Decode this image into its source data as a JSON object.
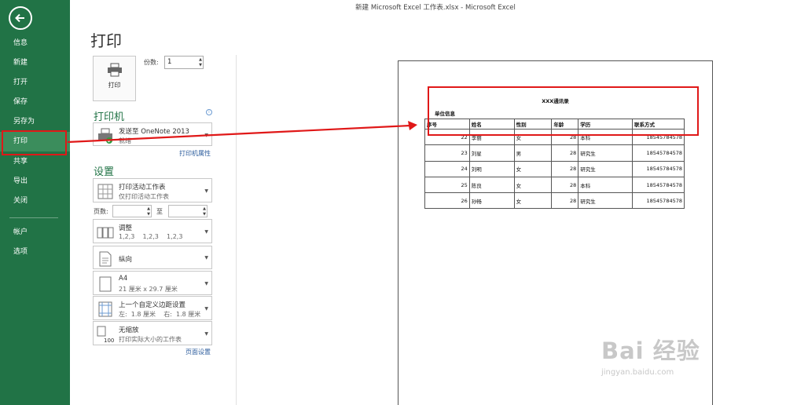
{
  "window": {
    "title": "新建 Microsoft Excel 工作表.xlsx - Microsoft Excel"
  },
  "nav": {
    "back_icon": "back-arrow-icon",
    "items": [
      {
        "label": "信息"
      },
      {
        "label": "新建"
      },
      {
        "label": "打开"
      },
      {
        "label": "保存"
      },
      {
        "label": "另存为"
      },
      {
        "label": "打印",
        "active": true
      },
      {
        "label": "共享"
      },
      {
        "label": "导出"
      },
      {
        "label": "关闭"
      },
      {
        "label": "帐户"
      },
      {
        "label": "选项"
      }
    ]
  },
  "print": {
    "heading": "打印",
    "button_label": "打印",
    "copies_label": "份数:",
    "copies_value": "1"
  },
  "printer": {
    "heading": "打印机",
    "name": "发送至 OneNote 2013",
    "status": "就绪",
    "properties_link": "打印机属性"
  },
  "settings": {
    "heading": "设置",
    "print_what": {
      "title": "打印活动工作表",
      "subtitle": "仅打印活动工作表"
    },
    "pages_label": "页数:",
    "pages_to_label": "至",
    "collate": {
      "title": "调整",
      "subtitle": "1,2,3    1,2,3    1,2,3"
    },
    "orientation": {
      "title": "纵向"
    },
    "paper": {
      "title": "A4",
      "subtitle": "21 厘米 x 29.7 厘米"
    },
    "margins": {
      "title": "上一个自定义边距设置",
      "subtitle": "左:  1.8 厘米    右:  1.8 厘米"
    },
    "scaling": {
      "title": "无缩放",
      "subtitle": "打印实际大小的工作表"
    },
    "page_setup_link": "页面设置"
  },
  "preview": {
    "sheet_title": "XXX通讯录",
    "unit_info": "单位信息",
    "columns": [
      "序号",
      "姓名",
      "性别",
      "年龄",
      "学历",
      "联系方式"
    ],
    "rows": [
      [
        "22",
        "李丽",
        "女",
        "28",
        "本科",
        "18545784578"
      ],
      [
        "23",
        "刘星",
        "男",
        "28",
        "研究生",
        "18545784578"
      ],
      [
        "24",
        "刘明",
        "女",
        "28",
        "研究生",
        "18545784578"
      ],
      [
        "25",
        "陈良",
        "女",
        "28",
        "本科",
        "18545784578"
      ],
      [
        "26",
        "孙畅",
        "女",
        "28",
        "研究生",
        "18545784578"
      ]
    ]
  },
  "watermark": {
    "brand": "Bai  经验",
    "url": "jingyan.baidu.com"
  },
  "colors": {
    "nav_green": "#217346",
    "nav_active": "#3b8d5c",
    "annotation_red": "#e01818"
  }
}
